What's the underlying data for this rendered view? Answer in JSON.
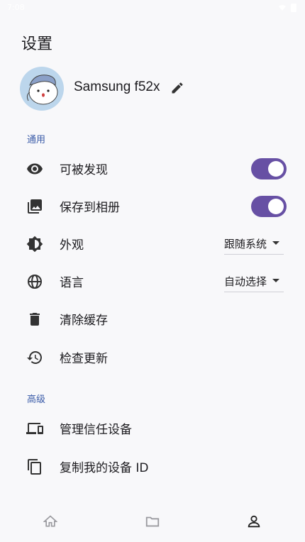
{
  "status_bar": {
    "time": "7:08",
    "signal_icon": "wifi-icon",
    "battery_icon": "battery-icon"
  },
  "header": {
    "title": "设置"
  },
  "profile": {
    "device_name": "Samsung f52x",
    "avatar_icon": "avatar-image",
    "edit_icon": "pencil-icon"
  },
  "sections": {
    "general": "通用",
    "advanced": "高级"
  },
  "general_items": [
    {
      "label": "可被发现",
      "icon": "eye-icon",
      "toggle": true
    },
    {
      "label": "保存到相册",
      "icon": "photo-icon",
      "toggle": true
    },
    {
      "label": "外观",
      "icon": "brightness-icon",
      "dropdown": "跟随系统"
    },
    {
      "label": "语言",
      "icon": "globe-icon",
      "dropdown": "自动选择"
    },
    {
      "label": "清除缓存",
      "icon": "trash-icon"
    },
    {
      "label": "检查更新",
      "icon": "history-icon"
    }
  ],
  "advanced_items": [
    {
      "label": "管理信任设备",
      "icon": "devices-icon"
    },
    {
      "label": "复制我的设备 ID",
      "icon": "copy-icon"
    }
  ],
  "bottom_nav": {
    "items": [
      "home-icon",
      "folder-icon",
      "person-icon"
    ],
    "active": "person-icon"
  },
  "colors": {
    "accent": "#6750a4",
    "section": "#3a5ba8",
    "background": "#f8f8fa"
  }
}
